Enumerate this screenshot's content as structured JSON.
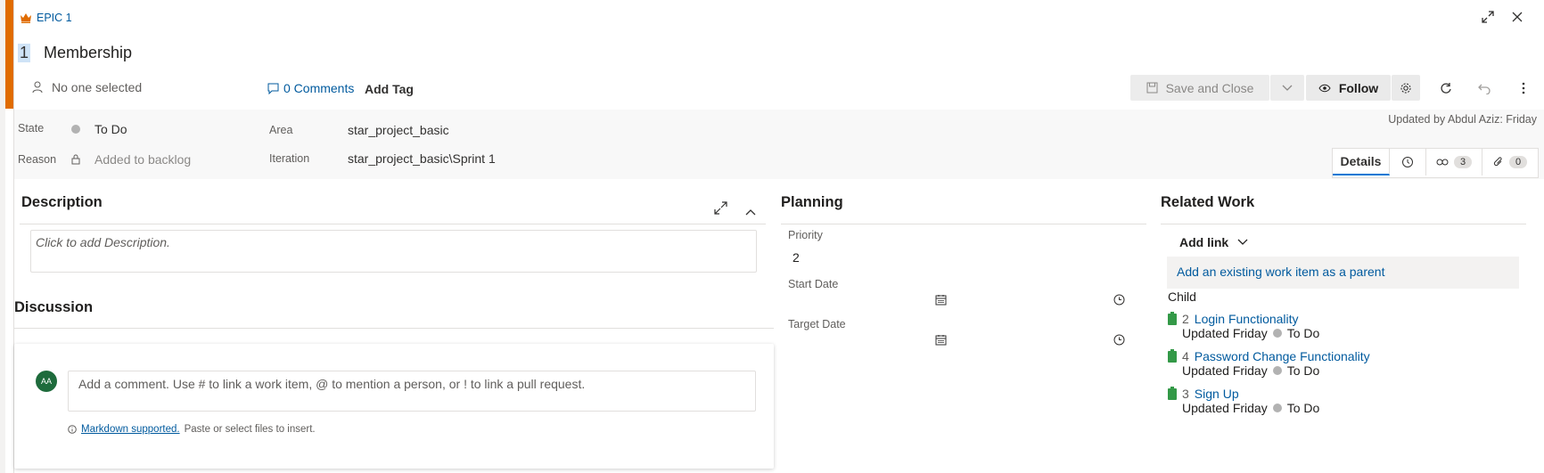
{
  "header": {
    "type_label": "EPIC 1",
    "id": "1",
    "title": "Membership",
    "assignee": "No one selected",
    "comments_label": "0 Comments",
    "add_tag": "Add Tag",
    "save_close": "Save and Close",
    "follow": "Follow",
    "updated": "Updated by Abdul Aziz: Friday"
  },
  "fields": {
    "state_label": "State",
    "state_value": "To Do",
    "reason_label": "Reason",
    "reason_value": "Added to backlog",
    "area_label": "Area",
    "area_value": "star_project_basic",
    "iteration_label": "Iteration",
    "iteration_value": "star_project_basic\\Sprint 1"
  },
  "tabs": {
    "details": "Details",
    "links_count": "3",
    "attachments_count": "0"
  },
  "description": {
    "title": "Description",
    "placeholder": "Click to add Description."
  },
  "discussion": {
    "title": "Discussion",
    "avatar_initials": "AA",
    "placeholder": "Add a comment. Use # to link a work item, @ to mention a person, or ! to link a pull request.",
    "markdown_link": "Markdown supported.",
    "markdown_hint": "Paste or select files to insert."
  },
  "planning": {
    "title": "Planning",
    "priority_label": "Priority",
    "priority_value": "2",
    "start_label": "Start Date",
    "target_label": "Target Date"
  },
  "related": {
    "title": "Related Work",
    "add_link": "Add link",
    "parent_link": "Add an existing work item as a parent",
    "child_header": "Child",
    "children": [
      {
        "id": "2",
        "title": "Login Functionality",
        "updated": "Updated Friday",
        "state": "To Do"
      },
      {
        "id": "4",
        "title": "Password Change Functionality",
        "updated": "Updated Friday",
        "state": "To Do"
      },
      {
        "id": "3",
        "title": "Sign Up",
        "updated": "Updated Friday",
        "state": "To Do"
      }
    ]
  },
  "colors": {
    "accent": "#e06c00",
    "link": "#005a9e",
    "child_icon": "#339947"
  }
}
